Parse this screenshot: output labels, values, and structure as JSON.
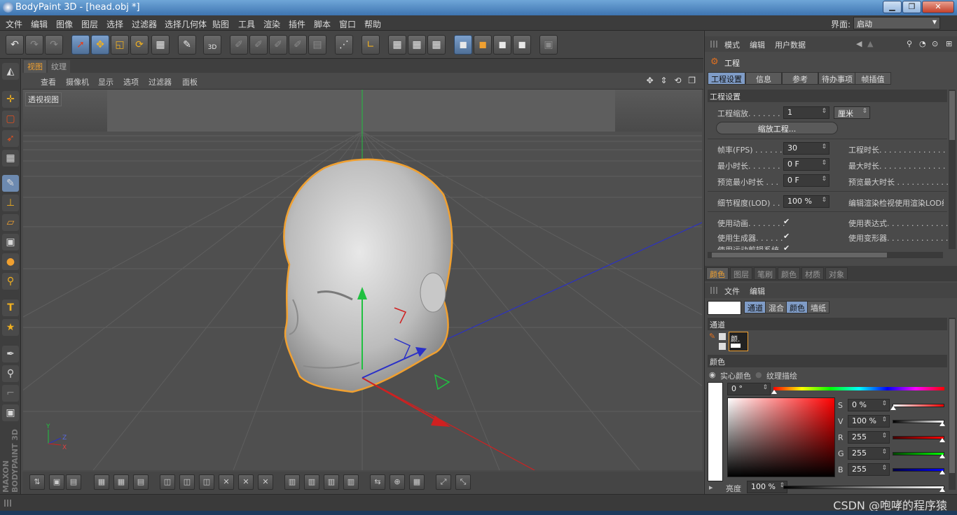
{
  "window": {
    "title": "BodyPaint 3D - [head.obj *]",
    "controls": [
      "▁",
      "❐",
      "✕"
    ]
  },
  "menubar": {
    "items": [
      "文件",
      "编辑",
      "图像",
      "图层",
      "选择",
      "过滤器",
      "选择几何体",
      "贴图",
      "工具",
      "渲染",
      "插件",
      "脚本",
      "窗口",
      "帮助"
    ],
    "layout_label": "界面:",
    "layout_value": "启动"
  },
  "toolbar": {
    "icons": [
      "undo-icon",
      "redo-icon",
      "redo2-icon",
      "select-icon",
      "move-icon",
      "scale-icon",
      "rotate-icon",
      "checker-icon",
      "wand-icon",
      "paint3d-icon",
      "tool-a-icon",
      "tool-b-icon",
      "tool-c-icon",
      "tool-d-icon",
      "tool-e-icon",
      "grid-icon",
      "axis-icon",
      "render-a-icon",
      "render-b-icon",
      "render-c-icon",
      "cube-a-icon",
      "cube-b-icon",
      "cube-c-icon",
      "cube-d-icon",
      "misc-icon"
    ],
    "paint3d_label": "3D"
  },
  "left_toolbar": {
    "icons": [
      "select-icon",
      "add-icon",
      "rect-select-icon",
      "lasso-icon",
      "checker-icon",
      "brush-icon",
      "stamp-icon",
      "eraser-icon",
      "gradient-icon",
      "drop-icon",
      "zoom-icon",
      "text-icon",
      "star-icon",
      "eyedropper-icon",
      "fill-icon",
      "path-icon",
      "frame-icon"
    ],
    "text_icon_glyph": "T",
    "brand": "MAXON BODYPAINT 3D"
  },
  "viewport": {
    "tabs": [
      "视图",
      "纹理"
    ],
    "menu": [
      "查看",
      "摄像机",
      "显示",
      "选项",
      "过滤器",
      "面板"
    ],
    "nav_icons": "✥ ⇕ ⟲ ❐",
    "label": "透视视图",
    "axis_labels": {
      "y": "Y",
      "z": "Z",
      "x": "X"
    }
  },
  "attributes": {
    "menu": [
      "模式",
      "编辑",
      "用户数据"
    ],
    "title": "工程",
    "tabs": [
      "工程设置",
      "信息",
      "参考",
      "待办事项",
      "帧插值"
    ],
    "section": "工程设置",
    "scale_label": "工程缩放. . . . . . .",
    "scale_value": "1",
    "scale_unit": "厘米",
    "scale_button": "缩放工程...",
    "fps_label": "帧率(FPS) . . . . . .",
    "fps_value": "30",
    "duration_label": "工程时长. . . . . . . . . . . . . . .",
    "min_time_label": "最小时长. . . . . . . .",
    "min_time_value": "0 F",
    "max_time_label": "最大时长. . . . . . . . . . . . . . .",
    "prev_min_label": "预览最小时长 . . .",
    "prev_min_value": "0 F",
    "prev_max_label": "预览最大时长 . . . . . . . . . . .",
    "lod_label": "细节程度(LOD) . .",
    "lod_value": "100 %",
    "lod_right_label": "编辑渲染检视使用渲染LOD级",
    "use_anim_label": "使用动画. . . . . . . .",
    "use_expr_label": "使用表达式. . . . . . . . . . . . .",
    "use_gen_label": "使用生成器. . . . . .",
    "use_deform_label": "使用变形器. . . . . . . . . . . . .",
    "use_motion_label": "使用运动剪辑系统",
    "check": "✔"
  },
  "color_panel": {
    "tabs": [
      "颜色",
      "图层",
      "笔刷",
      "颜色",
      "材质",
      "对象"
    ],
    "menu": [
      "文件",
      "编辑"
    ],
    "channel_tabs": [
      "通道",
      "混合",
      "颜色",
      "墙纸"
    ],
    "channel_section": "通道",
    "channel_name": "颜.",
    "color_section": "颜色",
    "solid_color": "实心颜色",
    "texture_paint": "纹理描绘",
    "hue_value": "0 °",
    "s_label": "S",
    "s_value": "0 %",
    "v_label": "V",
    "v_value": "100 %",
    "r_label": "R",
    "r_value": "255",
    "g_label": "G",
    "g_value": "255",
    "b_label": "B",
    "b_value": "255",
    "brightness_label": "亮度",
    "brightness_value": "100 %"
  },
  "status": {
    "watermark": "CSDN @咆哮的程序猿"
  },
  "colors": {
    "accent_orange": "#f0a030",
    "selection_blue": "#7f9cc7",
    "axis_red": "#d02020",
    "axis_green": "#20c040",
    "axis_blue": "#2030d0"
  }
}
